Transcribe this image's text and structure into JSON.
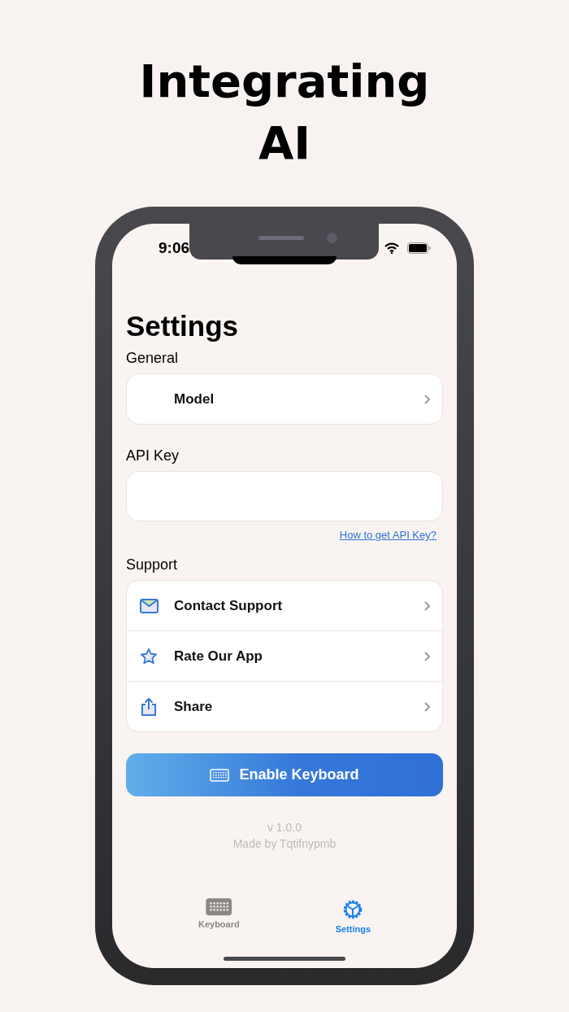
{
  "headline": "Integrating AI",
  "status_bar": {
    "time": "9:06"
  },
  "page_title": "Settings",
  "general": {
    "label": "General",
    "items": [
      {
        "label": "Model"
      }
    ]
  },
  "api_key": {
    "label": "API Key",
    "link": "How to get API Key?"
  },
  "support": {
    "label": "Support",
    "items": [
      {
        "kind": "mail",
        "label": "Contact Support"
      },
      {
        "kind": "star",
        "label": "Rate Our App"
      },
      {
        "kind": "share",
        "label": "Share"
      }
    ]
  },
  "primary_button": {
    "label": "Enable Keyboard"
  },
  "footer": {
    "version": "v 1.0.0",
    "credit": "Made by Tqtifnypmb"
  },
  "tabs": [
    {
      "kind": "keyboard",
      "label": "Keyboard",
      "selected": false
    },
    {
      "kind": "gear",
      "label": "Settings",
      "selected": true
    }
  ]
}
